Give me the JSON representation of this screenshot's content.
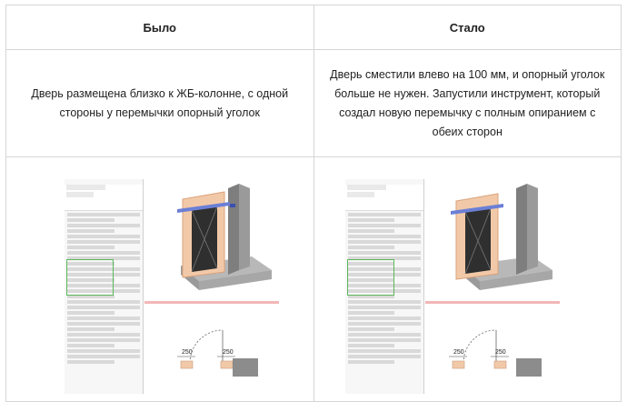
{
  "header": {
    "before_label": "Было",
    "after_label": "Стало"
  },
  "description": {
    "before_text": "Дверь размещена близко к ЖБ-колонне, с одной стороны у перемычки опорный уголок",
    "after_text": "Дверь сместили влево на 100 мм, и опорный уголок больше не нужен. Запустили инструмент, который создал новую перемычку с полным опиранием с обеих сторон"
  },
  "screenshots": {
    "before_dims": [
      "250",
      "250"
    ],
    "after_dims": [
      "250",
      "250"
    ]
  },
  "colors": {
    "border": "#d6d6d6",
    "highlight": "#5cb85c",
    "wall": "#8c8c8c",
    "door_frame": "#f2c9a8",
    "lintel": "#6b7fd6"
  }
}
